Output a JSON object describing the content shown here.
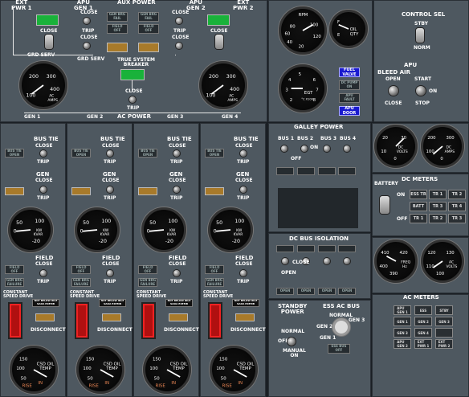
{
  "top": {
    "ext_pwr1": "EXT\nPWR 1",
    "apu_gen1": "APU\nGEN 1",
    "aux_power": "AUX POWER",
    "apu_gen2": "APU\nGEN 2",
    "ext_pwr2": "EXT\nPWR 2",
    "close": "CLOSE",
    "trip": "TRIP",
    "grd_serv": "GRD SERV",
    "gen_brg_fail": "GEN BRG\nFAIL",
    "field_off": "FIELD\nOFF",
    "tbus": "TRUE SYSTEM\nBREAKER",
    "ac_power": "AC POWER",
    "gen1": "GEN 1",
    "gen2": "GEN 2",
    "gen3": "GEN 3",
    "gen4": "GEN 4",
    "ac_amps": "AC\nAMPS"
  },
  "engine": {
    "rpm": "RPM",
    "oil_qty": "OIL\nQTY",
    "egt": "EGT",
    "egt_unit": "°C X100",
    "fuel_valve": "FUEL\nVALVE",
    "dc_pump_on": "DC PUMP\nON",
    "apu_fault": "APU\nFAULT",
    "apu_door": "APU\nDOOR"
  },
  "control": {
    "title": "CONTROL SEL",
    "stby": "STBY",
    "norm": "NORM",
    "apu": "APU",
    "bleed_air": "BLEED AIR",
    "open": "OPEN",
    "close": "CLOSE",
    "start": "START",
    "on": "ON",
    "stop": "STOP"
  },
  "gen_labels": {
    "bus_tie": "BUS TIE",
    "bus_tie_open": "BUS TIE\nOPEN",
    "close": "CLOSE",
    "trip": "TRIP",
    "gen": "GEN",
    "field": "FIELD",
    "field_off": "FIELD\nOFF",
    "gen_brg_fail": "GEN BRG\nFAILURE",
    "kw_kvar": "KW\nKVAR",
    "constant_speed_drive": "CONSTANT\nSPEED DRIVE",
    "not_below": "NOT BELOW IDLE\nSADA EXEMB",
    "disconnect": "DISCONNECT",
    "csd_oil_temp": "CSD OIL\nTEMP",
    "rise": "RISE",
    "in": "IN"
  },
  "galley": {
    "title": "GALLEY POWER",
    "bus1": "BUS 1",
    "bus2": "BUS 2",
    "bus3": "BUS 3",
    "bus4": "BUS 4",
    "on": "ON",
    "off": "OFF"
  },
  "dc_iso": {
    "title": "DC BUS ISOLATION",
    "open": "OPEN",
    "close": "CLOSE"
  },
  "standby": {
    "title": "STANDBY\nPOWER",
    "normal": "NORMAL",
    "off": "OFF",
    "manual_on": "MANUAL\nON",
    "ess_ac_bus": "ESS AC BUS",
    "gen2": "GEN 2",
    "gen3": "GEN 3",
    "gen1": "GEN 1",
    "ess_bus_off": "ESS BUS\nOFF"
  },
  "dc_volts": {
    "label": "DC\nVOLTS",
    "amps": "DC\nAMPS"
  },
  "dc_meters": {
    "title": "DC METERS",
    "battery": "BATTERY",
    "on": "ON",
    "off": "OFF",
    "row1": [
      "ESS TR",
      "TR 1",
      "TR 2"
    ],
    "row2": [
      "BATT",
      "TR 3",
      "TR 4"
    ],
    "row3": [
      "TR 1",
      "TR 2",
      "TR 3"
    ]
  },
  "ac_gauges": {
    "freq": "FREQ\nHz",
    "ac_volts": "AC\nVOLTS"
  },
  "ac_meters": {
    "title": "AC METERS",
    "col_l": [
      "APU\nGEN 1",
      "GEN 1",
      "GEN 3",
      "APU\nGEN 2"
    ],
    "col_m": [
      "ESS",
      "GEN 2",
      "GEN 4",
      "EXT\nPWR 1"
    ],
    "col_r": [
      "STBY",
      "GEN 3",
      "",
      "EXT\nPWR 2"
    ]
  }
}
